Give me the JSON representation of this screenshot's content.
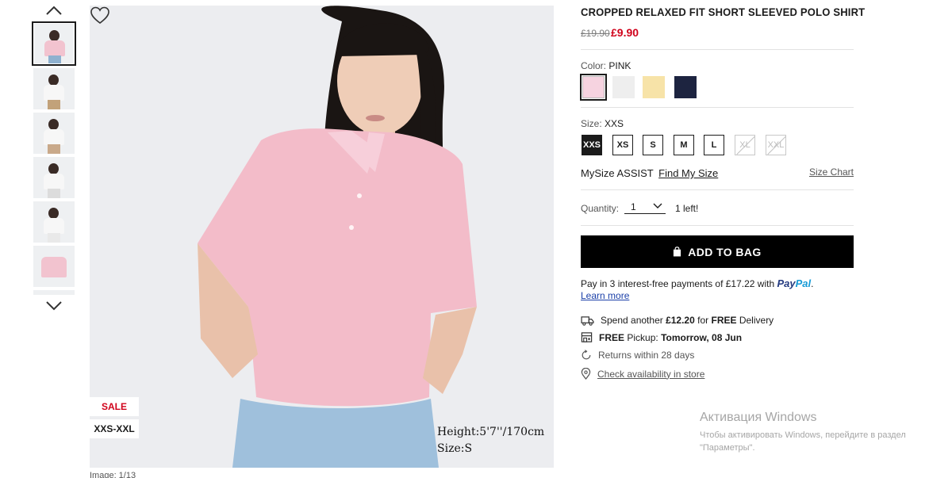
{
  "thumbnails": {
    "up_icon": "chevron-up-icon",
    "down_icon": "chevron-down-icon",
    "items": [
      {
        "body_color": "#f2c3cf",
        "legs_color": "#8fb1cf",
        "active": true
      },
      {
        "body_color": "#f7f7f7",
        "legs_color": "#c2a27a",
        "active": false
      },
      {
        "body_color": "#f7f7f7",
        "legs_color": "#c9a98a",
        "active": false
      },
      {
        "body_color": "#f7f7f7",
        "legs_color": "#dcdcdc",
        "active": false
      },
      {
        "body_color": "#f7f7f7",
        "legs_color": "#e9e9e9",
        "active": false
      },
      {
        "body_color": "#f2c3cf",
        "legs_color": "#eef0f2",
        "active": false
      }
    ]
  },
  "main_image": {
    "badges": {
      "sale": "SALE",
      "size_range": "XXS-XXL"
    },
    "model_height": "Height:5'7''/170cm",
    "model_size": "Size:S",
    "counter": "Image: 1/13",
    "wishlist_icon": "heart-icon"
  },
  "product": {
    "title": "CROPPED RELAXED FIT SHORT SLEEVED POLO SHIRT",
    "old_price": "£19.90",
    "new_price": "£9.90"
  },
  "color": {
    "label": "Color:",
    "selected": "PINK",
    "swatches": [
      "#f6d3e0",
      "#eeeeee",
      "#f7e3a8",
      "#1d2440"
    ]
  },
  "size": {
    "label": "Size:",
    "selected": "XXS",
    "options": [
      {
        "label": "XXS",
        "state": "active"
      },
      {
        "label": "XS",
        "state": "available"
      },
      {
        "label": "S",
        "state": "available"
      },
      {
        "label": "M",
        "state": "available"
      },
      {
        "label": "L",
        "state": "available"
      },
      {
        "label": "XL",
        "state": "disabled"
      },
      {
        "label": "XXL",
        "state": "disabled"
      }
    ],
    "mysize_label": "MySize ASSIST",
    "mysize_link": "Find My Size",
    "size_chart": "Size Chart"
  },
  "quantity": {
    "label": "Quantity:",
    "value": "1",
    "stock": "1 left!"
  },
  "add_to_bag": {
    "label": "ADD TO BAG",
    "icon": "shopping-bag-icon"
  },
  "paypal": {
    "text": "Pay in 3 interest-free payments of £17.22 with",
    "logo_a": "Pay",
    "logo_b": "Pal",
    "dot": ".",
    "learn_more": "Learn more"
  },
  "delivery": {
    "spend_prefix": "Spend another",
    "spend_amount": "£12.20",
    "spend_for": "for",
    "spend_free": "FREE",
    "spend_suffix": "Delivery",
    "pickup_free": "FREE",
    "pickup_label": "Pickup:",
    "pickup_date": "Tomorrow, 08 Jun",
    "returns": "Returns within 28 days",
    "store_link": "Check availability in store",
    "icons": [
      "truck-icon",
      "store-icon",
      "return-icon",
      "location-pin-icon"
    ]
  },
  "watermark": {
    "title": "Активация Windows",
    "line1": "Чтобы активировать Windows, перейдите в раздел",
    "line2": "\"Параметры\"."
  }
}
